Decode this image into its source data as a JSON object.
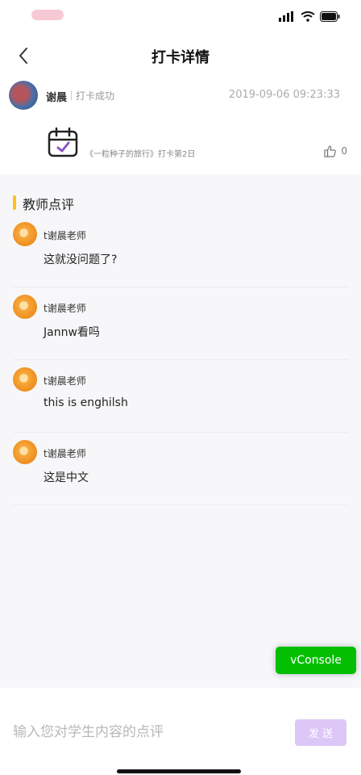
{
  "nav": {
    "title": "打卡详情"
  },
  "record": {
    "user_name": "谢晨",
    "status": "打卡成功",
    "time": "2019-09-06 09:23:33",
    "book": "《一粒种子的旅行》打卡第2日",
    "likes": "0"
  },
  "section": {
    "title": "教师点评"
  },
  "comments": [
    {
      "author": "t谢晨老师",
      "text": "这就没问题了?"
    },
    {
      "author": "t谢晨老师",
      "text": "Jannw看吗"
    },
    {
      "author": "t谢晨老师",
      "text": "this is enghilsh"
    },
    {
      "author": "t谢晨老师",
      "text": "这是中文"
    }
  ],
  "floating": {
    "vconsole_label": "vConsole"
  },
  "compose": {
    "placeholder": "输入您对学生内容的点评",
    "send_label": "发 送"
  },
  "colors": {
    "accent": "#ffc21d",
    "send_button": "#dcc7f7",
    "vconsole": "#04be02"
  }
}
